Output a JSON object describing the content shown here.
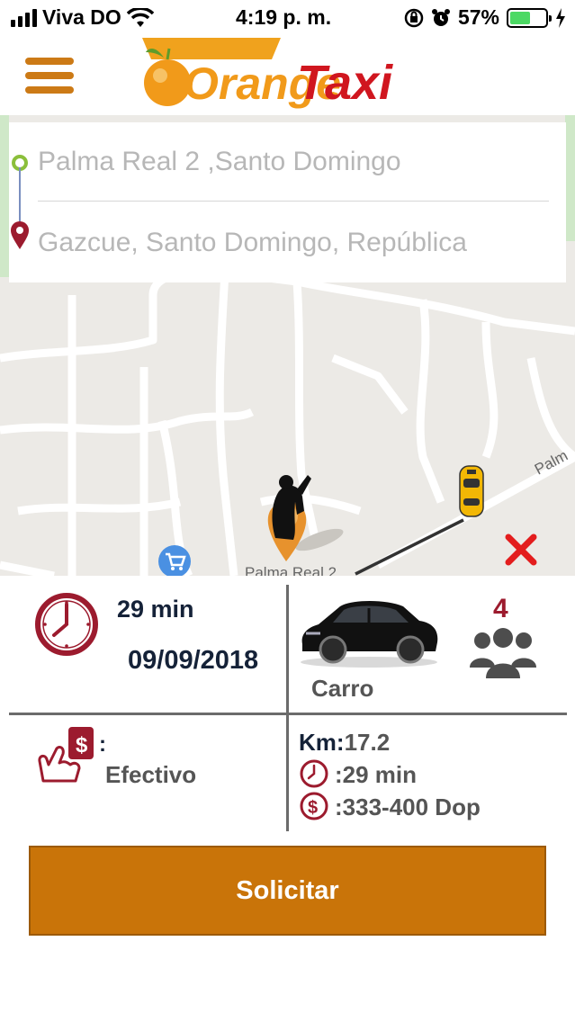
{
  "status_bar": {
    "carrier": "Viva DO",
    "time": "4:19 p. m.",
    "battery": "57%",
    "battery_level": 0.57
  },
  "header": {
    "logo_text_1": "Orange",
    "logo_text_2": "Taxi",
    "menu_icon": "hamburger-menu-icon"
  },
  "route": {
    "origin": "Palma Real 2 ,Santo Domingo",
    "destination": "Gazcue, Santo Domingo, República"
  },
  "map": {
    "street_label": "Palm",
    "place_label": "Palma Real 2"
  },
  "trip": {
    "duration": "29 min",
    "date": "09/09/2018",
    "vehicle": "Carro",
    "passengers": "4",
    "payment_colon": ":",
    "payment_method": "Efectivo",
    "km_label": "Km:",
    "km_value": "17.2",
    "time_estimate": ":29 min",
    "fare": ":333-400 Dop"
  },
  "actions": {
    "request_label": "Solicitar"
  },
  "colors": {
    "brand_orange": "#c97409",
    "logo_red": "#d0161f",
    "icon_red": "#9c1b2e"
  }
}
